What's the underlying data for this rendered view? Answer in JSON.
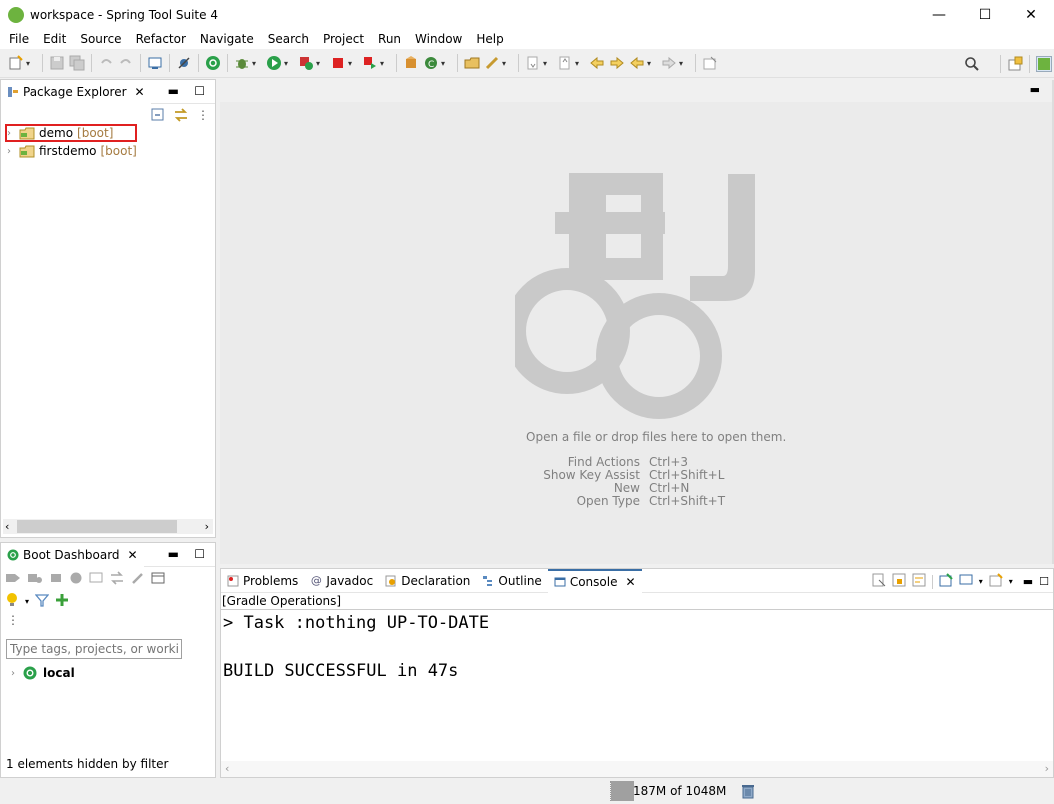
{
  "window": {
    "title": "workspace - Spring Tool Suite 4",
    "controls": {
      "minimize": "—",
      "maximize": "☐",
      "close": "✕"
    }
  },
  "menu": [
    "File",
    "Edit",
    "Source",
    "Refactor",
    "Navigate",
    "Search",
    "Project",
    "Run",
    "Window",
    "Help"
  ],
  "package_explorer": {
    "tab_label": "Package Explorer",
    "projects": [
      {
        "name": "demo",
        "tag": "[boot]",
        "highlighted": true
      },
      {
        "name": "firstdemo",
        "tag": "[boot]",
        "highlighted": false
      }
    ]
  },
  "boot_dashboard": {
    "tab_label": "Boot Dashboard",
    "filter_placeholder": "Type tags, projects, or working set names to match (incl. * and ? wildcards)",
    "filter_visible_text": "Type tags, projects, or working set na",
    "local_label": "local",
    "hidden_note": "1 elements hidden by filter"
  },
  "editor": {
    "drop_hint": "Open a file or drop files here to open them.",
    "shortcuts": [
      {
        "label": "Find Actions",
        "key": "Ctrl+3"
      },
      {
        "label": "Show Key Assist",
        "key": "Ctrl+Shift+L"
      },
      {
        "label": "New",
        "key": "Ctrl+N"
      },
      {
        "label": "Open Type",
        "key": "Ctrl+Shift+T"
      }
    ]
  },
  "bottom_tabs": {
    "problems": "Problems",
    "javadoc": "Javadoc",
    "declaration": "Declaration",
    "outline": "Outline",
    "console": "Console"
  },
  "console": {
    "header": "[Gradle Operations]",
    "line1": "> Task :nothing UP-TO-DATE",
    "line2": "BUILD SUCCESSFUL in 47s"
  },
  "status": {
    "heap": "187M of 1048M",
    "heap_used_fraction": 0.18
  },
  "colors": {
    "boot_green": "#6db33f",
    "boot_tag": "#a57b41",
    "highlight_red": "#e02020"
  }
}
